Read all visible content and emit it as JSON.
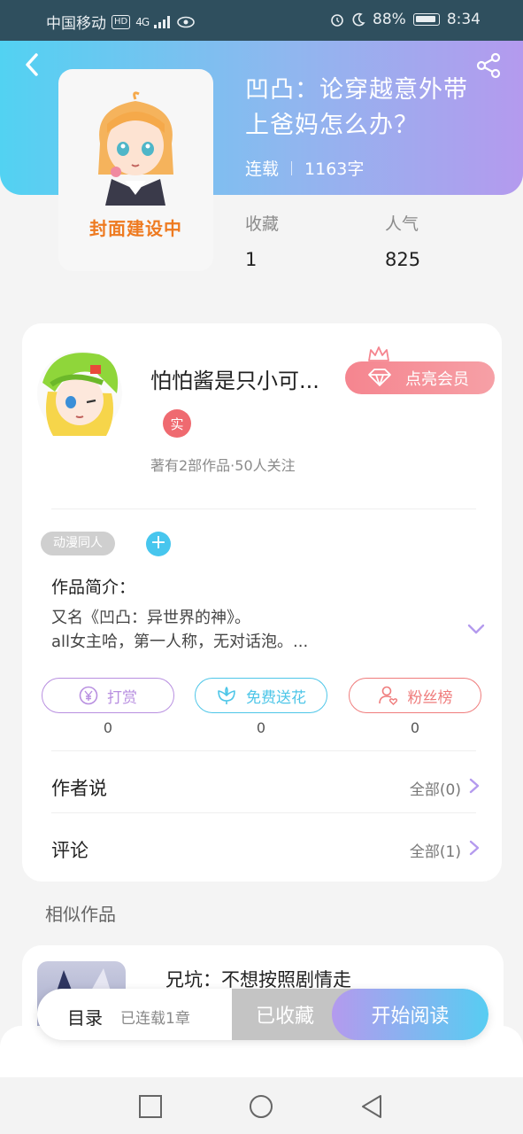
{
  "status_bar": {
    "carrier": "中国移动",
    "hd": "HD",
    "network": "4G",
    "battery": "88%",
    "time": "8:34"
  },
  "book": {
    "title": "凹凸：论穿越意外带上爸妈怎么办？",
    "status": "连载",
    "word_count": "1163字",
    "cover_text": "封面建设中"
  },
  "stats": {
    "collect_label": "收藏",
    "collect_value": "1",
    "popularity_label": "人气",
    "popularity_value": "825"
  },
  "author": {
    "name": "怕怕酱是只小可...",
    "vip_label": "点亮会员",
    "real_badge": "实",
    "sub": "著有2部作品·50人关注"
  },
  "tags": [
    "动漫同人"
  ],
  "tag_add": "+",
  "intro": {
    "label": "作品简介：",
    "text": "又名《凹凸：异世界的神》。\nall女主哈，第一人称，无对话泡。..."
  },
  "actions": [
    {
      "label": "打赏",
      "count": "0",
      "color": "#b88fe0",
      "icon": "yuan-coin-icon"
    },
    {
      "label": "免费送花",
      "count": "0",
      "color": "#4ec6e8",
      "icon": "flower-icon"
    },
    {
      "label": "粉丝榜",
      "count": "0",
      "color": "#ef7c7c",
      "icon": "fan-user-icon"
    }
  ],
  "rows": {
    "author_say_label": "作者说",
    "author_say_right": "全部(0)",
    "comments_label": "评论",
    "comments_right": "全部(1)"
  },
  "similar": {
    "title": "相似作品",
    "item_name": "兄坑：不想按照剧情走"
  },
  "bottom_bar": {
    "toc_label": "目录",
    "toc_sub": "已连载1章",
    "favorited_label": "已收藏",
    "read_label": "开始阅读"
  },
  "colors": {
    "accent_cyan": "#52d2f2",
    "accent_purple": "#b49aee",
    "vip_pink": "#f5858f"
  }
}
